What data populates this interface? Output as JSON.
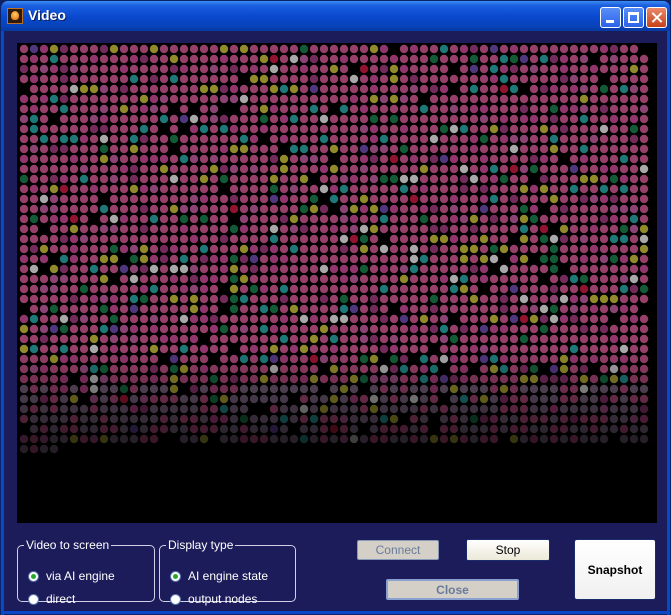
{
  "window": {
    "title": "Video"
  },
  "title_buttons": {
    "minimize": "minimize-icon",
    "maximize": "maximize-icon",
    "close": "close-icon"
  },
  "video_to_screen": {
    "legend": "Video to screen",
    "options": [
      {
        "label": "via AI engine",
        "selected": true
      },
      {
        "label": "direct",
        "selected": false
      }
    ]
  },
  "display_type": {
    "legend": "Display type",
    "options": [
      {
        "label": "AI engine state",
        "selected": true
      },
      {
        "label": "output nodes",
        "selected": false
      }
    ]
  },
  "buttons": {
    "connect": "Connect",
    "stop": "Stop",
    "close": "Close",
    "snapshot": "Snapshot"
  },
  "colors": {
    "window_bg": "#1c1c5a",
    "video_bg": "#000000",
    "node_colors": [
      "#c8548c",
      "#c24890",
      "#b85a9a",
      "#9a3a7a",
      "#c0b838",
      "#28a0a0",
      "#1a7a4a",
      "#e0e0e0",
      "#c01a40",
      "#6a4aa8"
    ]
  }
}
